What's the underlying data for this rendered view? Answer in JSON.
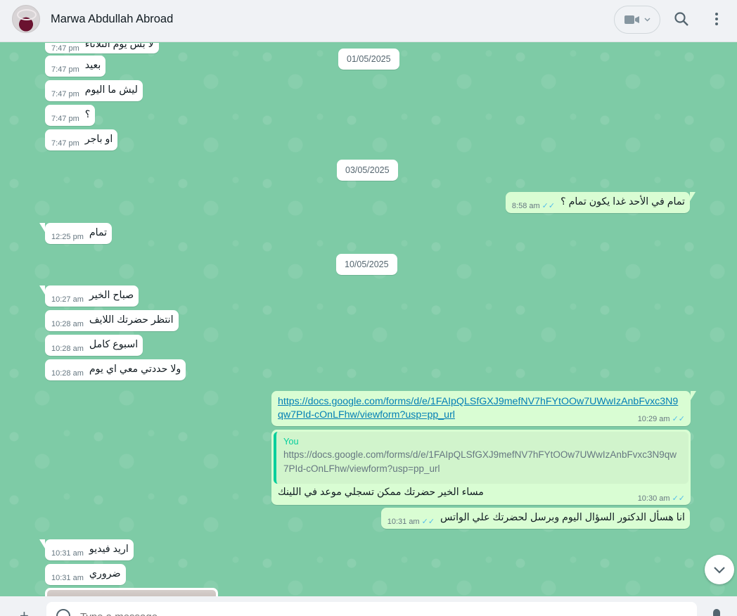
{
  "header": {
    "contact_name": "Marwa Abdullah Abroad",
    "video_icon": "video-camera-icon",
    "search_icon": "search-icon",
    "menu_icon": "more-vertical-icon"
  },
  "dates": [
    "01/05/2025",
    "03/05/2025",
    "10/05/2025"
  ],
  "messages": [
    {
      "dir": "in",
      "text": "لا بس يوم الثلاثاء",
      "time": "7:47 pm"
    },
    {
      "dir": "in",
      "text": "بعيد",
      "time": "7:47 pm"
    },
    {
      "dir": "in",
      "text": "ليش ما اليوم",
      "time": "7:47 pm"
    },
    {
      "dir": "in",
      "text": "؟",
      "time": "7:47 pm"
    },
    {
      "dir": "in",
      "text": "او باجر",
      "time": "7:47 pm"
    },
    {
      "dir": "out",
      "text": "تمام في الأحد غدا يكون تمام ؟",
      "time": "8:58 am"
    },
    {
      "dir": "in",
      "text": "تمام",
      "time": "12:25 pm"
    },
    {
      "dir": "in",
      "text": "صباح الخير",
      "time": "10:27 am"
    },
    {
      "dir": "in",
      "text": "انتظر حضرتك اللايف",
      "time": "10:28 am"
    },
    {
      "dir": "in",
      "text": "اسبوع كامل",
      "time": "10:28 am"
    },
    {
      "dir": "in",
      "text": "ولا حددتي معي اي يوم",
      "time": "10:28 am"
    },
    {
      "dir": "out",
      "text": "انا هسأل الدكتور السؤال اليوم وبرسل لحضرتك علي الواتس",
      "time": "10:31 am"
    },
    {
      "dir": "in",
      "text": "اريد فيديو",
      "time": "10:31 am"
    },
    {
      "dir": "in",
      "text": "ضروري",
      "time": "10:31 am"
    }
  ],
  "link_message": {
    "url": "https://docs.google.com/forms/d/e/1FAIpQLSfGXJ9mefNV7hFYtOOw7UWwIzAnbFvxc3N9qw7PId-cOnLFhw/viewform?usp=pp_url",
    "time": "10:29 am"
  },
  "reply_message": {
    "quote_author": "You",
    "quote_text": "https://docs.google.com/forms/d/e/1FAIpQLSfGXJ9mefNV7hFYtOOw7UWwIzAnbFvxc3N9qw7PId-cOnLFhw/viewform?usp=pp_url",
    "text": "مساء الخير حضرتك ممكن تسجلي موعد في اللينك",
    "time": "10:30 am"
  },
  "ticks": "✓✓",
  "composer": {
    "placeholder": "Type a message"
  },
  "colors": {
    "chat_bg": "#7ecba6",
    "out_bubble": "#d9fdd3",
    "in_bubble": "#ffffff",
    "link": "#027eb5",
    "read_ticks": "#53bdeb"
  }
}
